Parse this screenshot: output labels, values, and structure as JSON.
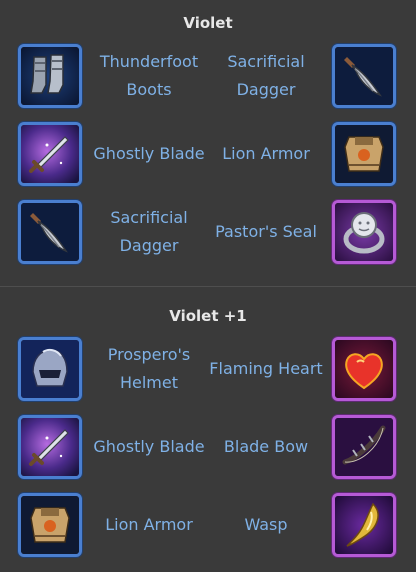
{
  "sections": [
    {
      "title": "Violet",
      "rows": [
        {
          "left": {
            "name": "Thunderfoot Boots",
            "icon": "boots-icon",
            "rarity": "blue"
          },
          "right": {
            "name": "Sacrificial Dagger",
            "icon": "dagger-icon",
            "rarity": "blue"
          }
        },
        {
          "left": {
            "name": "Ghostly Blade",
            "icon": "sword-icon",
            "rarity": "blue"
          },
          "right": {
            "name": "Lion Armor",
            "icon": "armor-icon",
            "rarity": "blue"
          }
        },
        {
          "left": {
            "name": "Sacrificial Dagger",
            "icon": "dagger-icon",
            "rarity": "blue"
          },
          "right": {
            "name": "Pastor's Seal",
            "icon": "ring-icon",
            "rarity": "purple"
          }
        }
      ]
    },
    {
      "title": "Violet +1",
      "rows": [
        {
          "left": {
            "name": "Prospero's Helmet",
            "icon": "helmet-icon",
            "rarity": "blue"
          },
          "right": {
            "name": "Flaming Heart",
            "icon": "heart-icon",
            "rarity": "purple"
          }
        },
        {
          "left": {
            "name": "Ghostly Blade",
            "icon": "sword-icon",
            "rarity": "blue"
          },
          "right": {
            "name": "Blade Bow",
            "icon": "bow-icon",
            "rarity": "purple"
          }
        },
        {
          "left": {
            "name": "Lion Armor",
            "icon": "armor-icon",
            "rarity": "blue"
          },
          "right": {
            "name": "Wasp",
            "icon": "wasp-icon",
            "rarity": "purple"
          }
        }
      ]
    }
  ],
  "colors": {
    "background": "#3a3a3a",
    "heading": "#e8e8e8",
    "item_name": "#7fb1e6",
    "rarity_blue": "#4a7fd0",
    "rarity_purple": "#b65ad6"
  }
}
